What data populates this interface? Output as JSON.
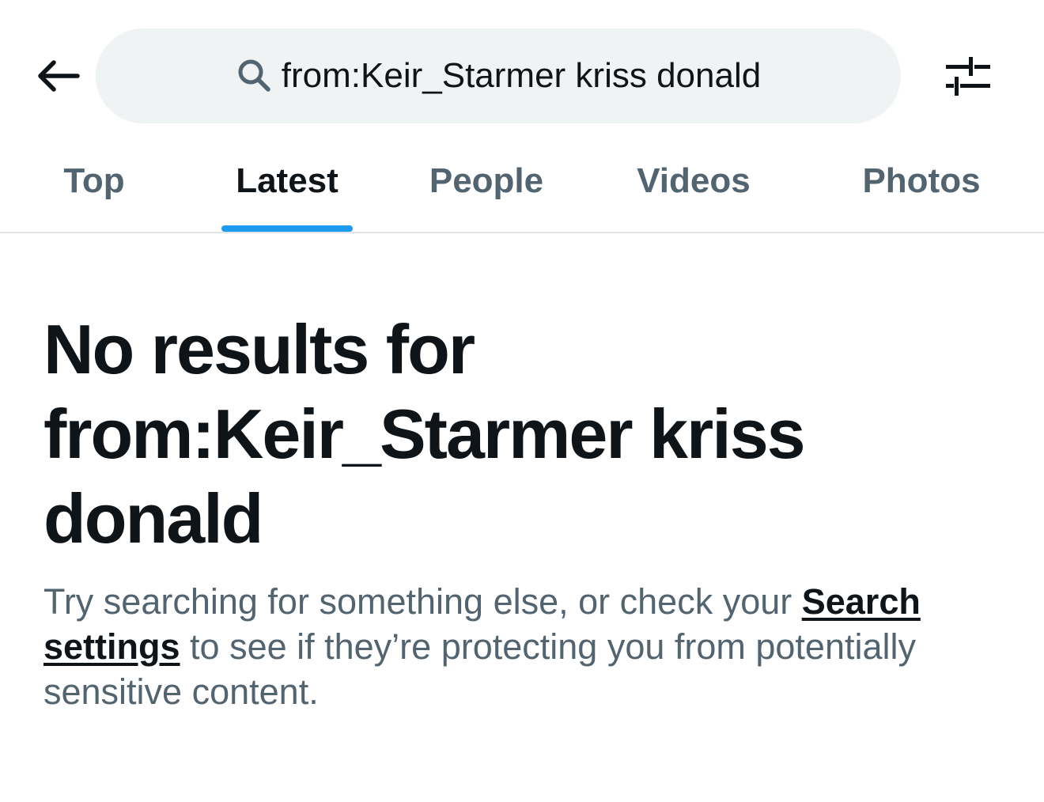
{
  "header": {
    "back_icon": "back-arrow-icon",
    "search": {
      "icon": "search-icon",
      "query": "from:Keir_Starmer kriss donald"
    },
    "filter_icon": "search-filter-sliders-icon"
  },
  "tabs": [
    {
      "label": "Top",
      "active": false
    },
    {
      "label": "Latest",
      "active": true
    },
    {
      "label": "People",
      "active": false
    },
    {
      "label": "Videos",
      "active": false
    },
    {
      "label": "Photos",
      "active": false
    }
  ],
  "empty_state": {
    "title_prefix": "No results for",
    "title_query": "from:Keir_Starmer kriss donald",
    "body_before_link": "Try searching for something else, or check your ",
    "link_label": "Search settings",
    "body_after_link": " to see if they’re protecting you from potentially sensitive content."
  },
  "colors": {
    "accent": "#1d9bf0",
    "text_primary": "#0f1419",
    "text_secondary": "#536471",
    "search_bg": "#eff3f4",
    "divider": "#e1e6ea"
  }
}
